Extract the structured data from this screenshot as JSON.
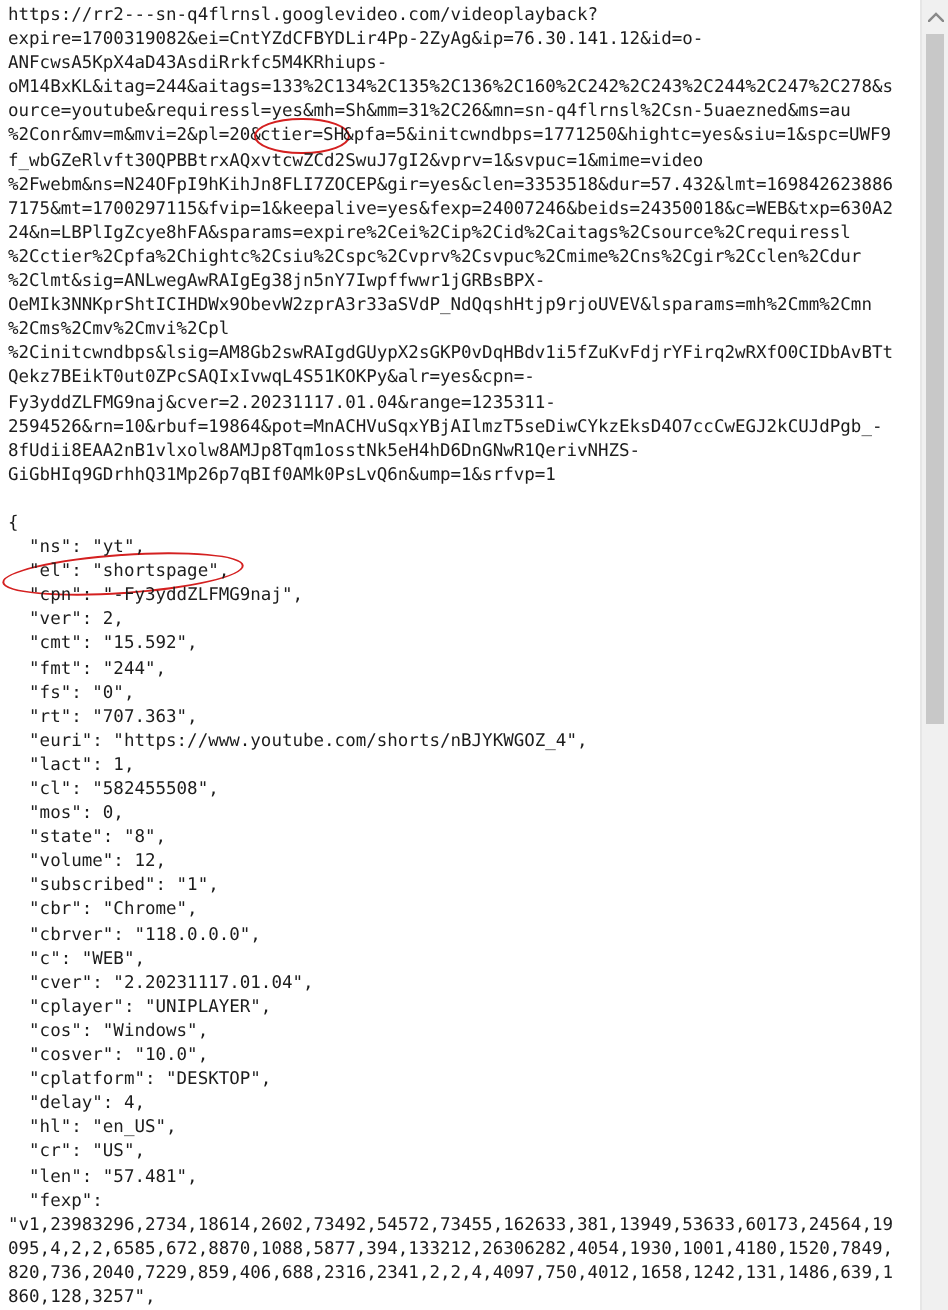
{
  "document": {
    "blocks": [
      {
        "lines": [
          "https://rr2---sn-q4flrnsl.googlevideo.com/videoplayback?",
          "expire=1700319082&ei=CntYZdCFBYDLir4Pp-2ZyAg&ip=76.30.141.12&id=o-",
          "ANFcwsA5KpX4aD43AsdiRrkfc5M4KRhiups-",
          "oM14BxKL&itag=244&aitags=133%2C134%2C135%2C136%2C160%2C242%2C243%2C244%2C247%2C278&s",
          "ource=youtube&requiressl=yes&mh=Sh&mm=31%2C26&mn=sn-q4flrnsl%2Csn-5uaezned&ms=au",
          {
            "kind": "circled",
            "before": "%2Conr&mv=m&mvi=2&pl=20&",
            "circled": "ctier=SH",
            "after": "&pfa=5&initcwndbps=1771250&hightc=yes&siu=1&spc=UWF9"
          },
          "f_wbGZeRlvft30QPBBtrxAQxvtcwZCd2SwuJ7gI2&vprv=1&svpuc=1&mime=video",
          "%2Fwebm&ns=N24OFpI9hKihJn8FLI7ZOCEP&gir=yes&clen=3353518&dur=57.432&lmt=169842623886",
          "7175&mt=1700297115&fvip=1&keepalive=yes&fexp=24007246&beids=24350018&c=WEB&txp=630A2",
          "24&n=LBPlIgZcye8hFA&sparams=expire%2Cei%2Cip%2Cid%2Caitags%2Csource%2Crequiressl",
          "%2Cctier%2Cpfa%2Chightc%2Csiu%2Cspc%2Cvprv%2Csvpuc%2Cmime%2Cns%2Cgir%2Cclen%2Cdur",
          "%2Clmt&sig=ANLwegAwRAIgEg38jn5nY7Iwpffwwr1jGRBsBPX-",
          "OeMIk3NNKprShtICIHDWx9ObevW2zprA3r33aSVdP_NdQqshHtjp9rjoUVEV&lsparams=mh%2Cmm%2Cmn",
          "%2Cms%2Cmv%2Cmvi%2Cpl",
          "%2Cinitcwndbps&lsig=AM8Gb2swRAIgdGUypX2sGKP0vDqHBdv1i5fZuKvFdjrYFirq2wRXfO0CIDbAvBTt",
          "Qekz7BEikT0ut0ZPcSAQIxIvwqL4S51KOKPy&alr=yes&cpn=-",
          "Fy3yddZLFMG9naj&cver=2.20231117.01.04&range=1235311-",
          "2594526&rn=10&rbuf=19864&pot=MnACHVuSqxYBjAIlmzT5seDiwCYkzEksD4O7ccCwEGJ2kCUJdPgb_-",
          "8fUdii8EAA2nB1vlxolw8AMJp8Tqm1osstNk5eH4hD6DnGNwR1QerivNHZS-",
          "GiGbHIq9GDrhhQ31Mp26p7qBIf0AMk0PsLvQ6n&ump=1&srfvp=1"
        ]
      },
      {
        "lines": [
          "{",
          "  \"ns\": \"yt\",",
          "  \"el\": \"shortspage\",",
          "  \"cpn\": \"-Fy3yddZLFMG9naj\",",
          "  \"ver\": 2,",
          "  \"cmt\": \"15.592\",",
          "  \"fmt\": \"244\",",
          "  \"fs\": \"0\",",
          "  \"rt\": \"707.363\",",
          "  \"euri\": \"https://www.youtube.com/shorts/nBJYKWGOZ_4\",",
          "  \"lact\": 1,",
          "  \"cl\": \"582455508\",",
          "  \"mos\": 0,",
          "  \"state\": \"8\",",
          "  \"volume\": 12,",
          "  \"subscribed\": \"1\",",
          "  \"cbr\": \"Chrome\",",
          "  \"cbrver\": \"118.0.0.0\",",
          "  \"c\": \"WEB\",",
          "  \"cver\": \"2.20231117.01.04\",",
          "  \"cplayer\": \"UNIPLAYER\",",
          "  \"cos\": \"Windows\",",
          "  \"cosver\": \"10.0\",",
          "  \"cplatform\": \"DESKTOP\",",
          "  \"delay\": 4,",
          "  \"hl\": \"en_US\",",
          "  \"cr\": \"US\",",
          "  \"len\": \"57.481\",",
          "  \"fexp\":",
          "\"v1,23983296,2734,18614,2602,73492,54572,73455,162633,381,13949,53633,60173,24564,19",
          "095,4,2,2,6585,672,8870,1088,5877,394,133212,26306282,4054,1930,1001,4180,1520,7849,",
          "820,736,2040,7229,859,406,688,2316,2341,2,2,4,4097,750,4012,1658,1242,131,1486,639,1",
          "860,128,3257\","
        ]
      }
    ]
  }
}
